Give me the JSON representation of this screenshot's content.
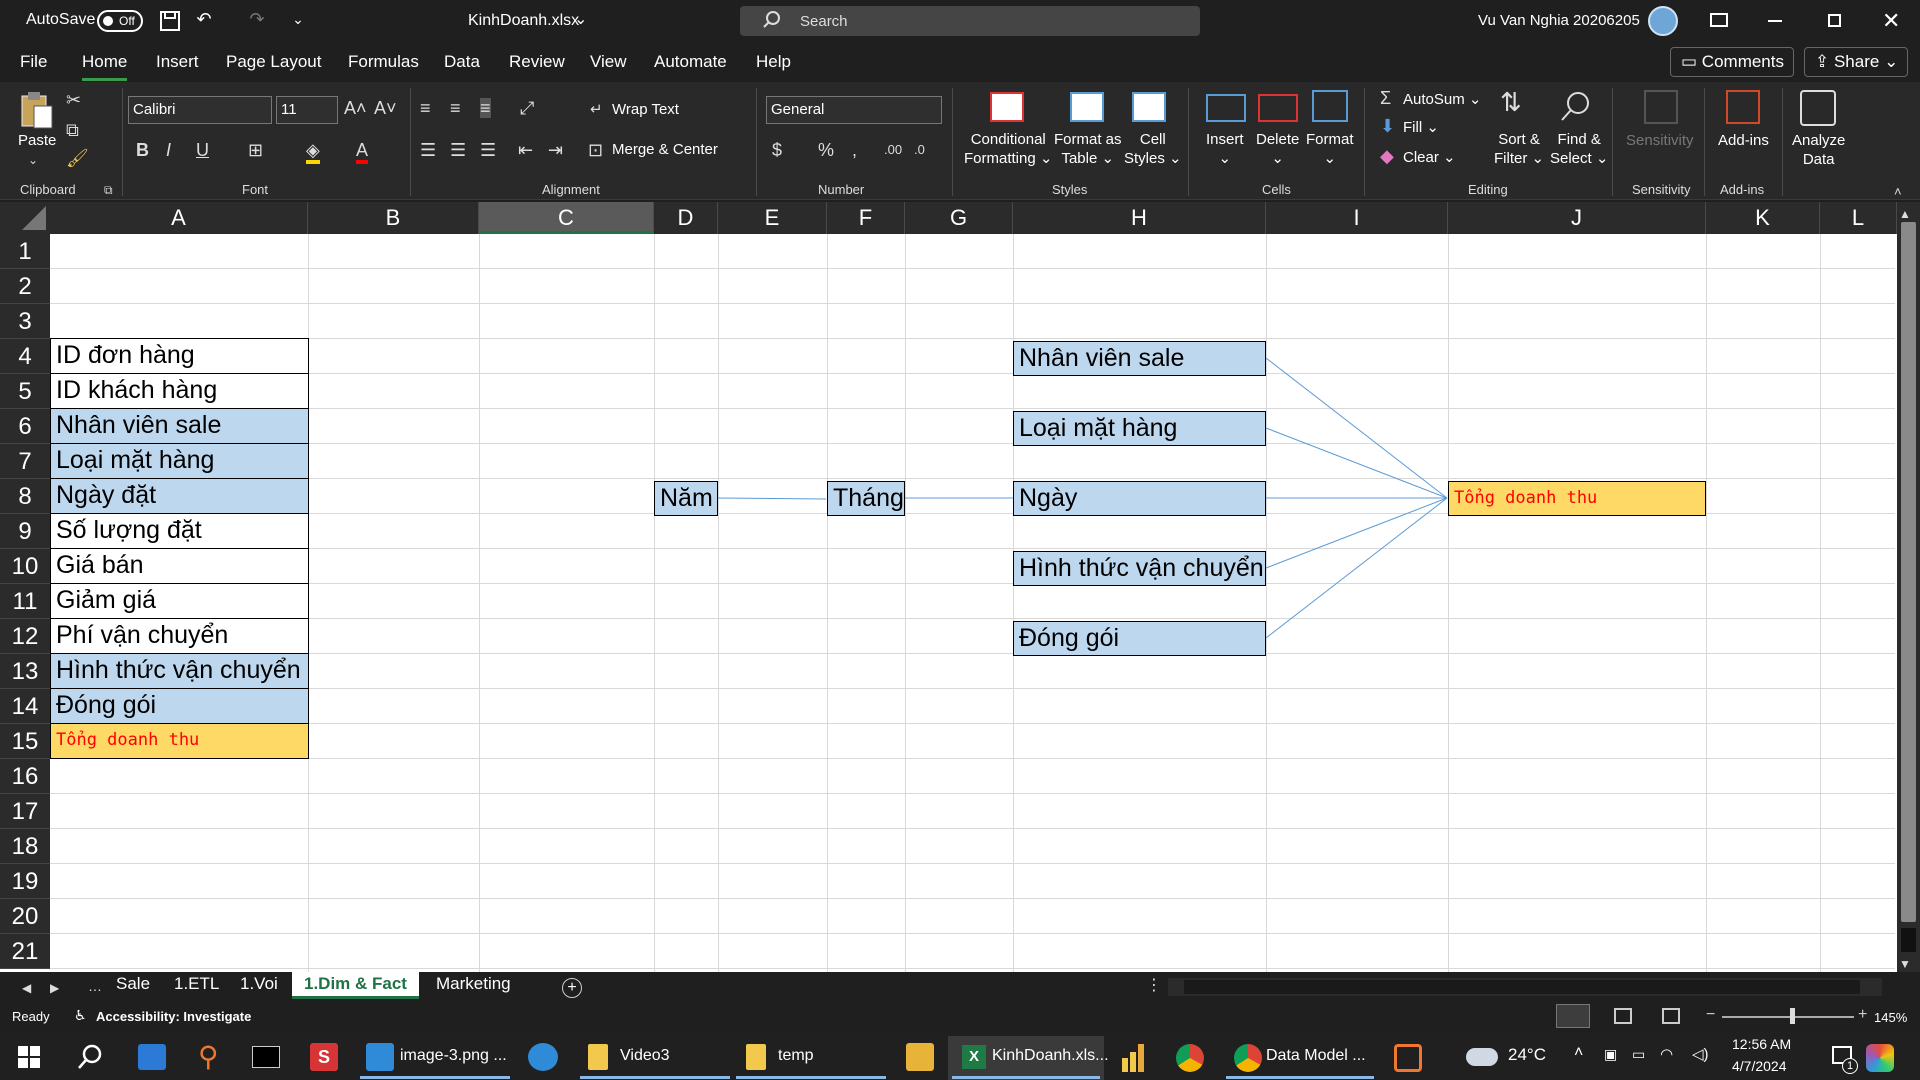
{
  "titlebar": {
    "autosave_label": "AutoSave",
    "autosave_state": "Off",
    "filename": "KinhDoanh.xlsx",
    "search_placeholder": "Search",
    "user": "Vu Van Nghia 20206205"
  },
  "menu": {
    "items": [
      "File",
      "Home",
      "Insert",
      "Page Layout",
      "Formulas",
      "Data",
      "Review",
      "View",
      "Automate",
      "Help"
    ],
    "active": "Home",
    "comments": "Comments",
    "share": "Share"
  },
  "ribbon": {
    "clipboard": {
      "label": "Clipboard",
      "paste": "Paste"
    },
    "font": {
      "label": "Font",
      "name": "Calibri",
      "size": "11"
    },
    "alignment": {
      "label": "Alignment",
      "wrap": "Wrap Text",
      "merge": "Merge & Center"
    },
    "number": {
      "label": "Number",
      "format": "General"
    },
    "styles": {
      "label": "Styles",
      "cond1": "Conditional",
      "cond2": "Formatting",
      "fmt1": "Format as",
      "fmt2": "Table",
      "cell1": "Cell",
      "cell2": "Styles"
    },
    "cells": {
      "label": "Cells",
      "insert": "Insert",
      "delete": "Delete",
      "format": "Format"
    },
    "editing": {
      "label": "Editing",
      "autosum": "AutoSum",
      "fill": "Fill",
      "clear": "Clear",
      "sort1": "Sort &",
      "sort2": "Filter",
      "find1": "Find &",
      "find2": "Select"
    },
    "sensitivity": {
      "label": "Sensitivity",
      "button": "Sensitivity"
    },
    "addins": {
      "label": "Add-ins",
      "button": "Add-ins"
    },
    "analyze": {
      "line1": "Analyze",
      "line2": "Data"
    }
  },
  "columns": [
    "A",
    "B",
    "C",
    "D",
    "E",
    "F",
    "G",
    "H",
    "I",
    "J",
    "K",
    "L"
  ],
  "selected_column": "C",
  "rows": [
    "1",
    "2",
    "3",
    "4",
    "5",
    "6",
    "7",
    "8",
    "9",
    "10",
    "11",
    "12",
    "13",
    "14",
    "15",
    "16",
    "17",
    "18",
    "19",
    "20",
    "21"
  ],
  "column_a": [
    {
      "text": "ID đơn hàng",
      "style": "white"
    },
    {
      "text": "ID khách hàng",
      "style": "white"
    },
    {
      "text": "Nhân viên sale",
      "style": "blue"
    },
    {
      "text": "Loại mặt hàng",
      "style": "blue"
    },
    {
      "text": "Ngày đặt",
      "style": "blue"
    },
    {
      "text": "Số lượng đặt",
      "style": "white"
    },
    {
      "text": "Giá bán",
      "style": "white"
    },
    {
      "text": "Giảm giá",
      "style": "white"
    },
    {
      "text": "Phí vận chuyển",
      "style": "white"
    },
    {
      "text": "Hình thức vận chuyển",
      "style": "blue"
    },
    {
      "text": "Đóng gói",
      "style": "blue"
    },
    {
      "text": "Tổng doanh thu",
      "style": "gold"
    }
  ],
  "diagram": {
    "year": "Năm",
    "month": "Tháng",
    "dimensions": [
      "Nhân viên sale",
      "Loại mặt hàng",
      "Ngày",
      "Hình thức vận chuyển",
      "Đóng gói"
    ],
    "fact": "Tổng doanh thu"
  },
  "sheets": [
    "Sale",
    "1.ETL",
    "1.Voi",
    "1.Dim & Fact",
    "Marketing"
  ],
  "active_sheet": "1.Dim & Fact",
  "status": {
    "ready": "Ready",
    "accessibility": "Accessibility: Investigate",
    "zoom": "145%"
  },
  "taskbar": {
    "apps": [
      "image-3.png ...",
      "Video3",
      "temp",
      "KinhDoanh.xls...",
      "Data Model ..."
    ],
    "weather": "24°C",
    "time": "12:56 AM",
    "date": "4/7/2024",
    "notif": "1"
  },
  "colors": {
    "accent": "#217346",
    "dim_fill": "#bdd7ee",
    "fact_fill": "#ffd966",
    "fact_text": "#ff0000",
    "connector": "#5b9bd5"
  }
}
